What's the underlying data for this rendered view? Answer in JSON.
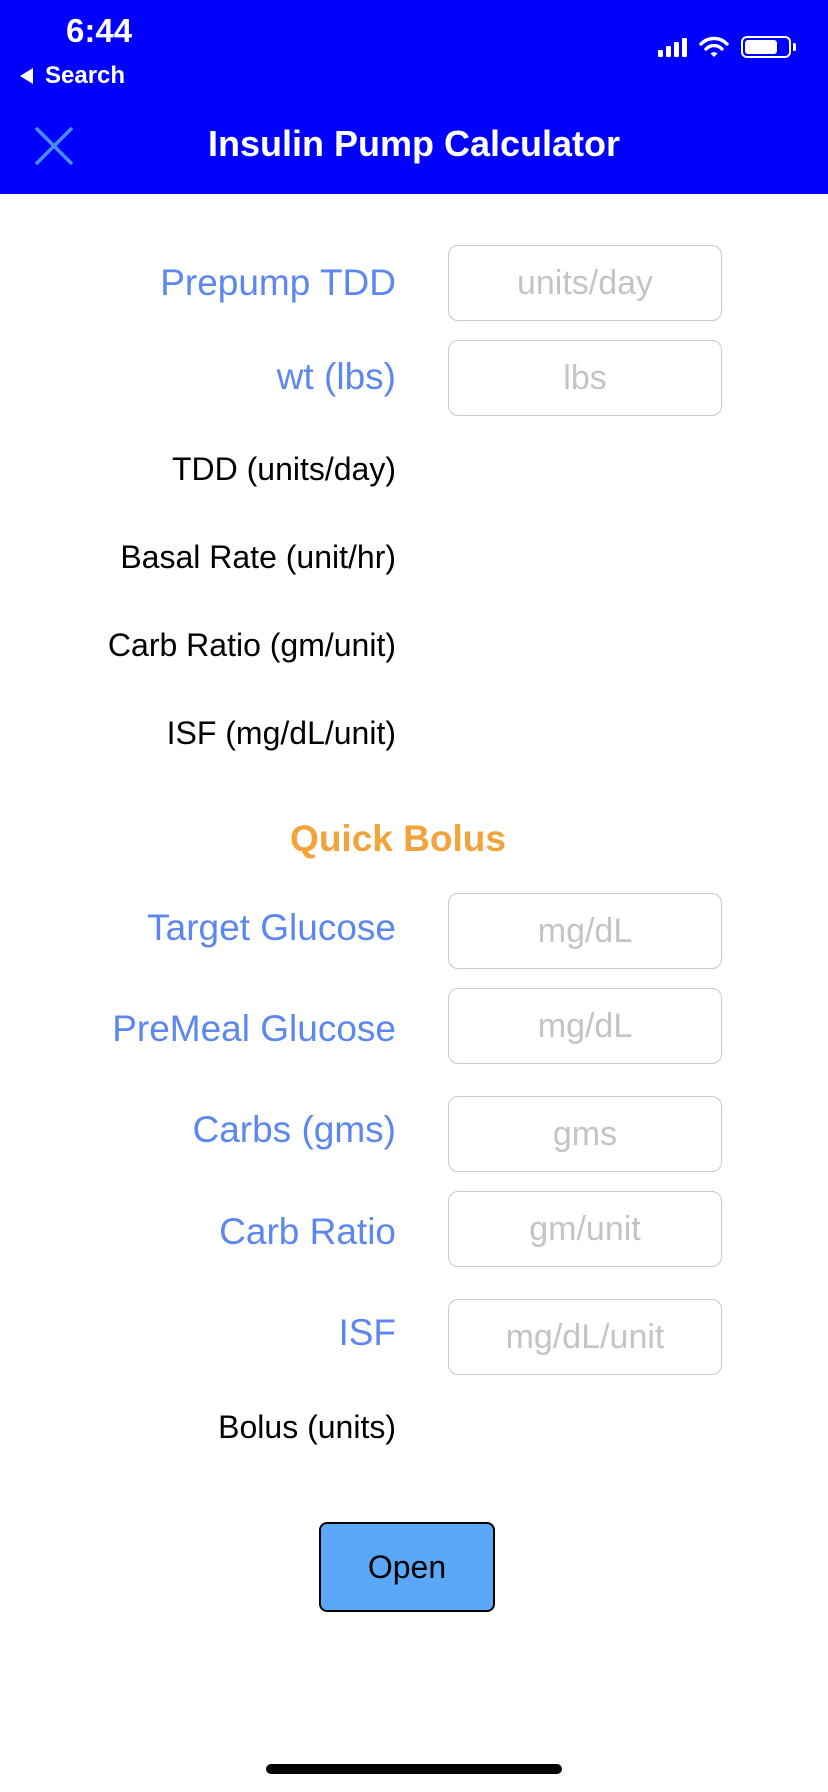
{
  "status_bar": {
    "time": "6:44",
    "back_label": "Search",
    "battery_level": 0.75
  },
  "header": {
    "title": "Insulin Pump Calculator",
    "close_icon": "close-icon",
    "background_color": "#0000ff"
  },
  "pump_settings": {
    "prepump_tdd": {
      "label": "Prepump TDD",
      "value": "",
      "placeholder": "units/day"
    },
    "weight": {
      "label": "wt (lbs)",
      "value": "",
      "placeholder": "lbs"
    },
    "tdd_label": "TDD (units/day)",
    "basal_rate_label": "Basal Rate (unit/hr)",
    "carb_ratio_label": "Carb Ratio (gm/unit)",
    "isf_label": "ISF (mg/dL/unit)"
  },
  "quick_bolus": {
    "title": "Quick Bolus",
    "target_glucose": {
      "label": "Target Glucose",
      "value": "",
      "placeholder": "mg/dL"
    },
    "premeal_glucose": {
      "label": "PreMeal Glucose",
      "value": "",
      "placeholder": "mg/dL"
    },
    "carbs": {
      "label": "Carbs (gms)",
      "value": "",
      "placeholder": "gms"
    },
    "carb_ratio": {
      "label": "Carb Ratio",
      "value": "",
      "placeholder": "gm/unit"
    },
    "isf": {
      "label": "ISF",
      "value": "",
      "placeholder": "mg/dL/unit"
    },
    "bolus_label": "Bolus (units)"
  },
  "open_button": {
    "label": "Open"
  },
  "colors": {
    "label_blue": "#5c87f0",
    "section_orange": "#f2a33a",
    "button_blue": "#5aa8f7"
  }
}
